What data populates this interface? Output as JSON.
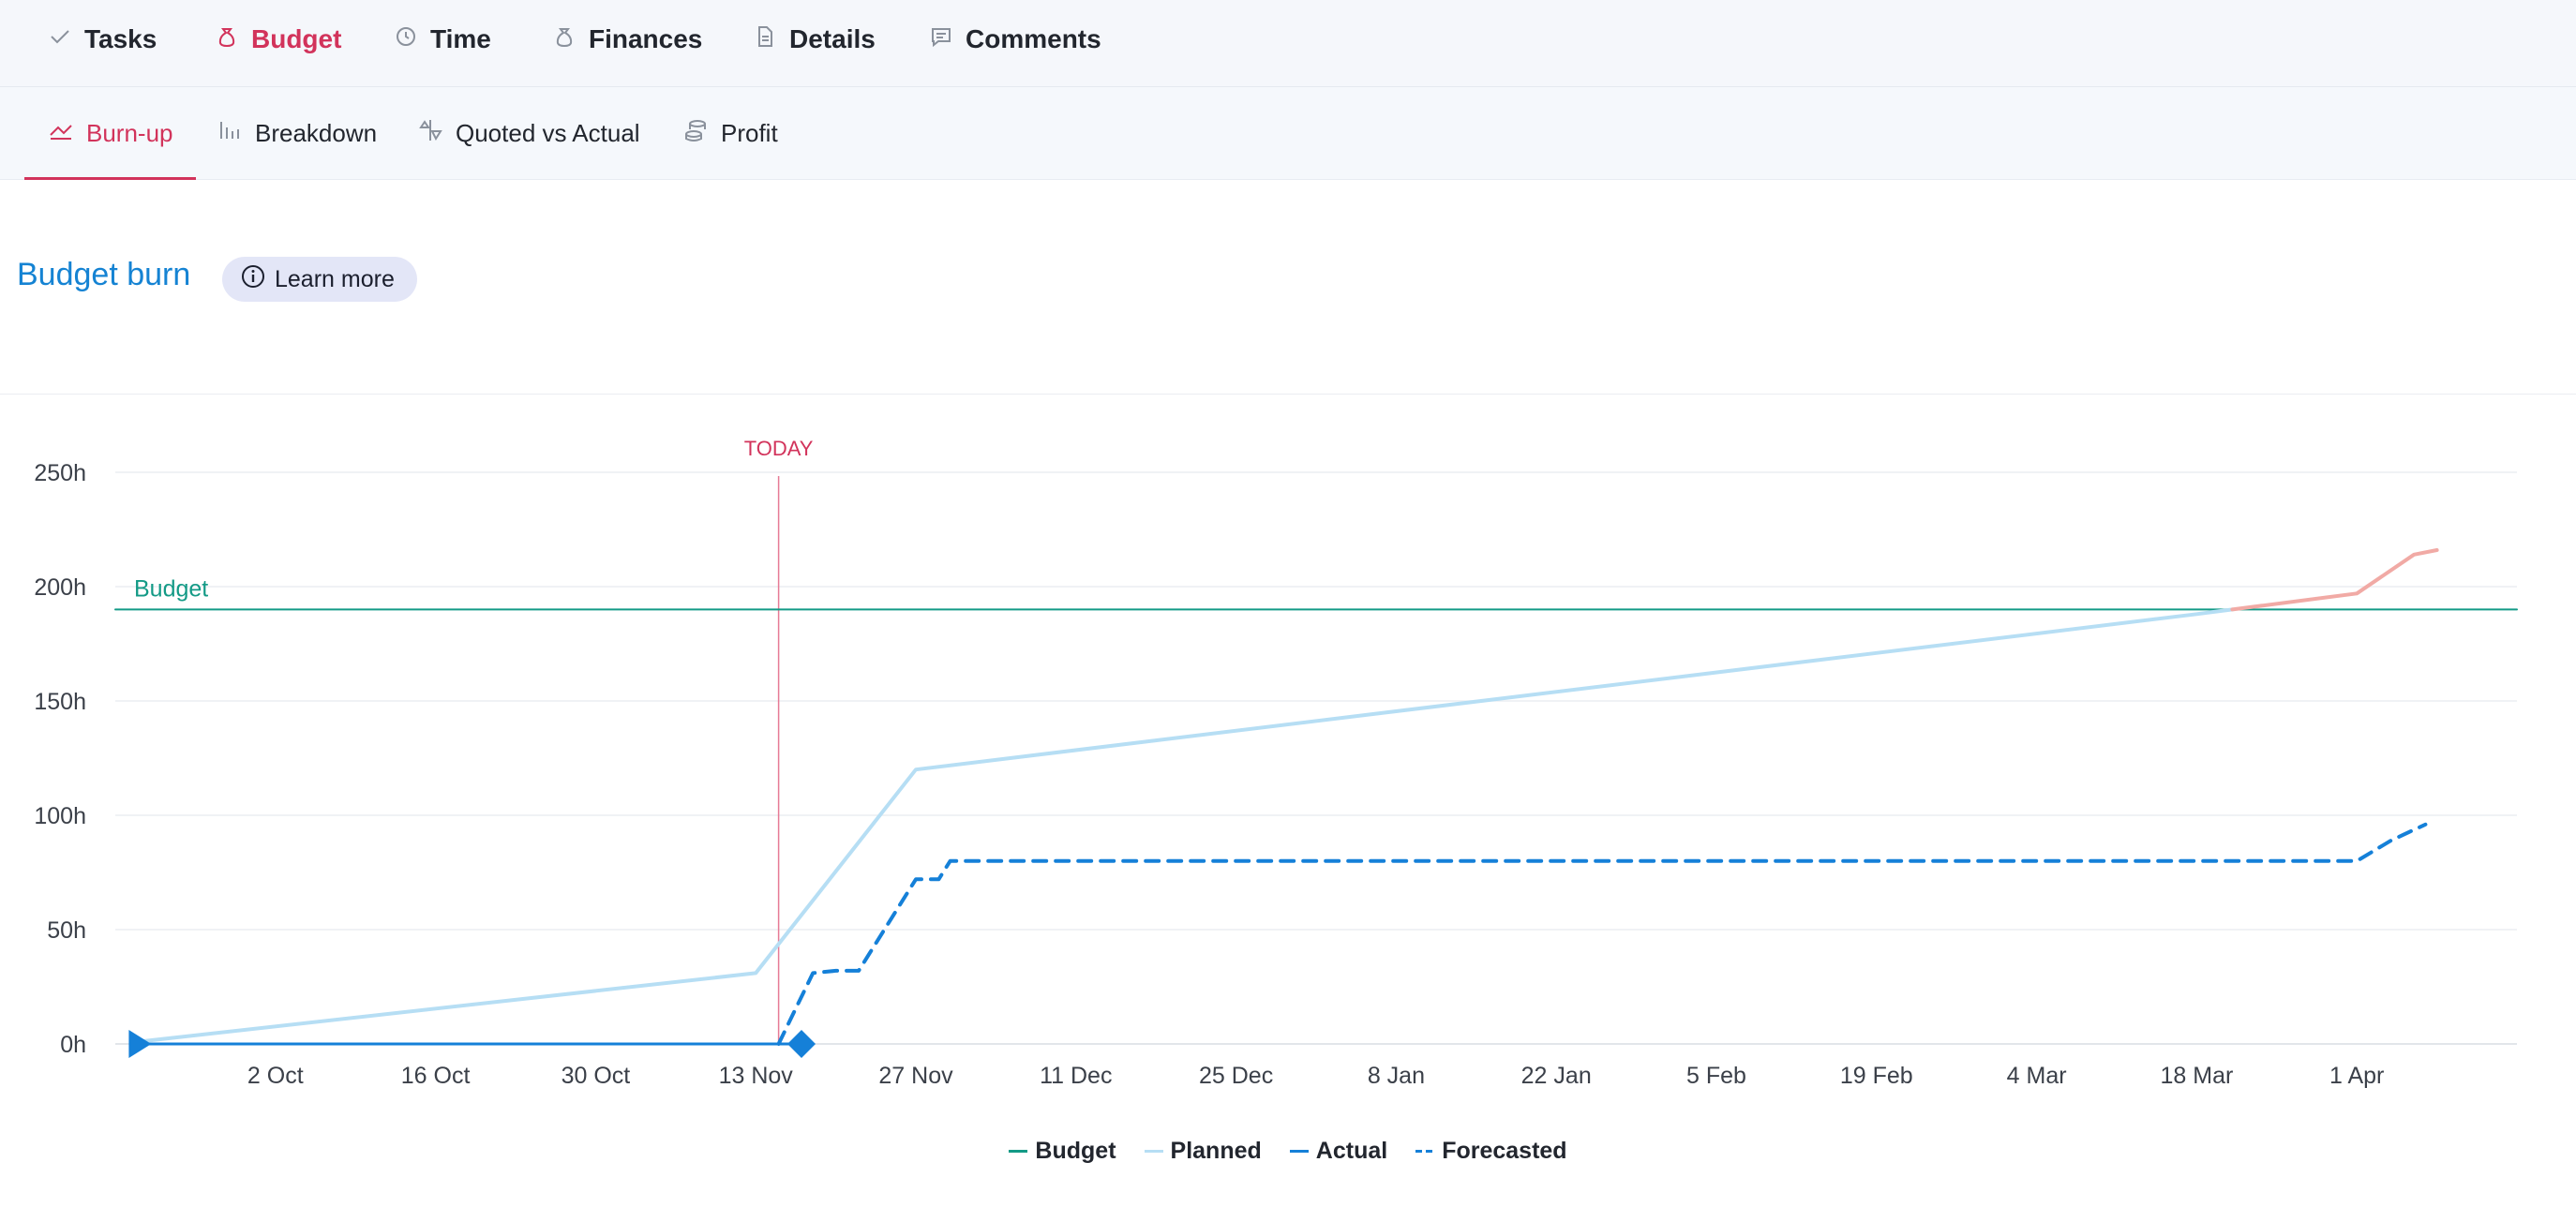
{
  "top_tabs": [
    {
      "label": "Tasks",
      "icon": "check-icon",
      "active": false
    },
    {
      "label": "Budget",
      "icon": "money-bag-icon",
      "active": true
    },
    {
      "label": "Time",
      "icon": "clock-icon",
      "active": false
    },
    {
      "label": "Finances",
      "icon": "money-bag-icon",
      "active": false
    },
    {
      "label": "Details",
      "icon": "document-icon",
      "active": false
    },
    {
      "label": "Comments",
      "icon": "comment-icon",
      "active": false
    }
  ],
  "sub_tabs": [
    {
      "label": "Burn-up",
      "icon": "burn-up-icon",
      "active": true
    },
    {
      "label": "Breakdown",
      "icon": "bar-chart-icon",
      "active": false
    },
    {
      "label": "Quoted vs Actual",
      "icon": "quoted-vs-actual-icon",
      "active": false
    },
    {
      "label": "Profit",
      "icon": "coins-icon",
      "active": false
    }
  ],
  "section": {
    "title": "Budget burn",
    "learn_more_label": "Learn more"
  },
  "colors": {
    "accent": "#d2335b",
    "link": "#1583d3",
    "budget": "#139a86",
    "planned": "#b6def4",
    "planned_over": "#f1aaa5",
    "actual": "#1580d8",
    "forecasted": "#1580d8",
    "today": "#e77a95"
  },
  "chart_data": {
    "type": "line",
    "y_ticks": [
      "0h",
      "50h",
      "100h",
      "150h",
      "200h",
      "250h"
    ],
    "ylim": [
      0,
      250
    ],
    "x_ticks": [
      "2 Oct",
      "16 Oct",
      "30 Oct",
      "13 Nov",
      "27 Nov",
      "11 Dec",
      "25 Dec",
      "8 Jan",
      "22 Jan",
      "5 Feb",
      "19 Feb",
      "4 Mar",
      "18 Mar",
      "1 Apr"
    ],
    "x_tick_days": [
      14,
      28,
      42,
      56,
      70,
      84,
      98,
      112,
      126,
      140,
      154,
      168,
      182,
      196
    ],
    "x_domain_days": [
      0,
      210
    ],
    "x_unit_note": "days from 18 Sep",
    "grid": true,
    "today_label": "TODAY",
    "today_day": 58,
    "budget_label": "Budget",
    "budget_value": 190,
    "series": [
      {
        "name": "Budget",
        "style": "solid",
        "color_key": "budget",
        "points": [
          [
            0,
            190
          ],
          [
            210,
            190
          ]
        ]
      },
      {
        "name": "Planned",
        "style": "solid",
        "color_key": "planned",
        "points": [
          [
            2,
            1
          ],
          [
            56,
            31
          ],
          [
            70,
            120
          ],
          [
            154,
            171
          ],
          [
            182,
            188
          ],
          [
            196,
            197
          ],
          [
            201,
            214
          ],
          [
            203,
            216
          ]
        ]
      },
      {
        "name": "Actual",
        "style": "solid",
        "color_key": "actual",
        "points": [
          [
            2,
            0
          ],
          [
            58,
            0
          ],
          [
            61,
            0
          ]
        ]
      },
      {
        "name": "Forecasted",
        "style": "dashed",
        "color_key": "forecasted",
        "points": [
          [
            58,
            0
          ],
          [
            61,
            31
          ],
          [
            63,
            32
          ],
          [
            65,
            32
          ],
          [
            70,
            72
          ],
          [
            72,
            72
          ],
          [
            73,
            80
          ],
          [
            196,
            80
          ],
          [
            199,
            89
          ],
          [
            202,
            96
          ]
        ]
      }
    ],
    "markers": [
      {
        "type": "triangle",
        "day": 2,
        "value": 0
      },
      {
        "type": "diamond",
        "day": 60,
        "value": 0
      }
    ],
    "legend": [
      "Budget",
      "Planned",
      "Actual",
      "Forecasted"
    ],
    "legend_position": "bottom-center"
  }
}
